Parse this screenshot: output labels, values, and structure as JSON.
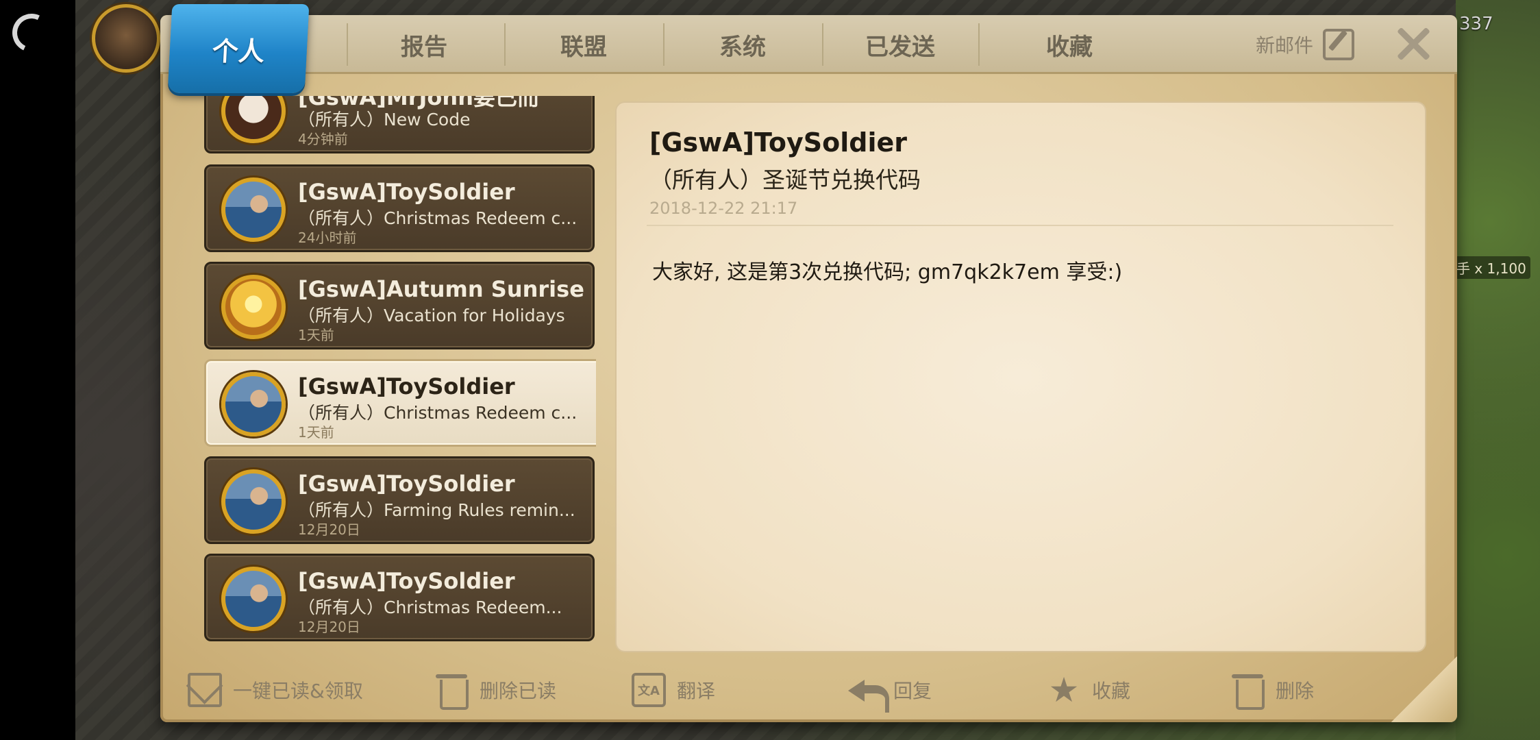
{
  "hud": {
    "resource_count": "337",
    "troop_count": "手 x 1,100"
  },
  "tabs": [
    {
      "label": "个人",
      "active": true
    },
    {
      "label": "报告"
    },
    {
      "label": "联盟"
    },
    {
      "label": "系统"
    },
    {
      "label": "已发送"
    },
    {
      "label": "收藏"
    }
  ],
  "header": {
    "new_mail_label": "新邮件",
    "new_mail_icon": "compose-icon",
    "close_icon": "close-icon"
  },
  "mails": [
    {
      "sender": "[GswA]MrJohn要已而",
      "subject": "（所有人）New Code",
      "time": "4分钟前",
      "avatar": "skull-face"
    },
    {
      "sender": "[GswA]ToySoldier",
      "subject": "（所有人）Christmas Redeem c...",
      "time": "24小时前",
      "avatar": "sea-portrait"
    },
    {
      "sender": "[GswA]Autumn Sunrise",
      "subject": "（所有人）Vacation for Holidays",
      "time": "1天前",
      "avatar": "sunrise"
    },
    {
      "sender": "[GswA]ToySoldier",
      "subject": "（所有人）Christmas Redeem c...",
      "time": "1天前",
      "avatar": "sea-portrait",
      "selected": true
    },
    {
      "sender": "[GswA]ToySoldier",
      "subject": "（所有人）Farming Rules remin...",
      "time": "12月20日",
      "avatar": "sea-portrait"
    },
    {
      "sender": "[GswA]ToySoldier",
      "subject": "（所有人）Christmas Redeem...",
      "time": "12月20日",
      "avatar": "sea-portrait"
    }
  ],
  "detail": {
    "sender": "[GswA]ToySoldier",
    "subject": "（所有人）圣诞节兑换代码",
    "date": "2018-12-22 21:17",
    "body": "大家好, 这是第3次兑换代码; gm7qk2k7em 享受:)"
  },
  "toolbar": {
    "read_all_label": "一键已读&领取",
    "delete_read_label": "删除已读",
    "translate_label": "翻译",
    "translate_glyph": "文A",
    "reply_label": "回复",
    "favorite_label": "收藏",
    "delete_label": "删除"
  },
  "colors": {
    "active_tab": "#1f84c8",
    "panel": "#d5bd8a",
    "list_item": "#4a3b29",
    "selected_item": "#f4ead8"
  }
}
